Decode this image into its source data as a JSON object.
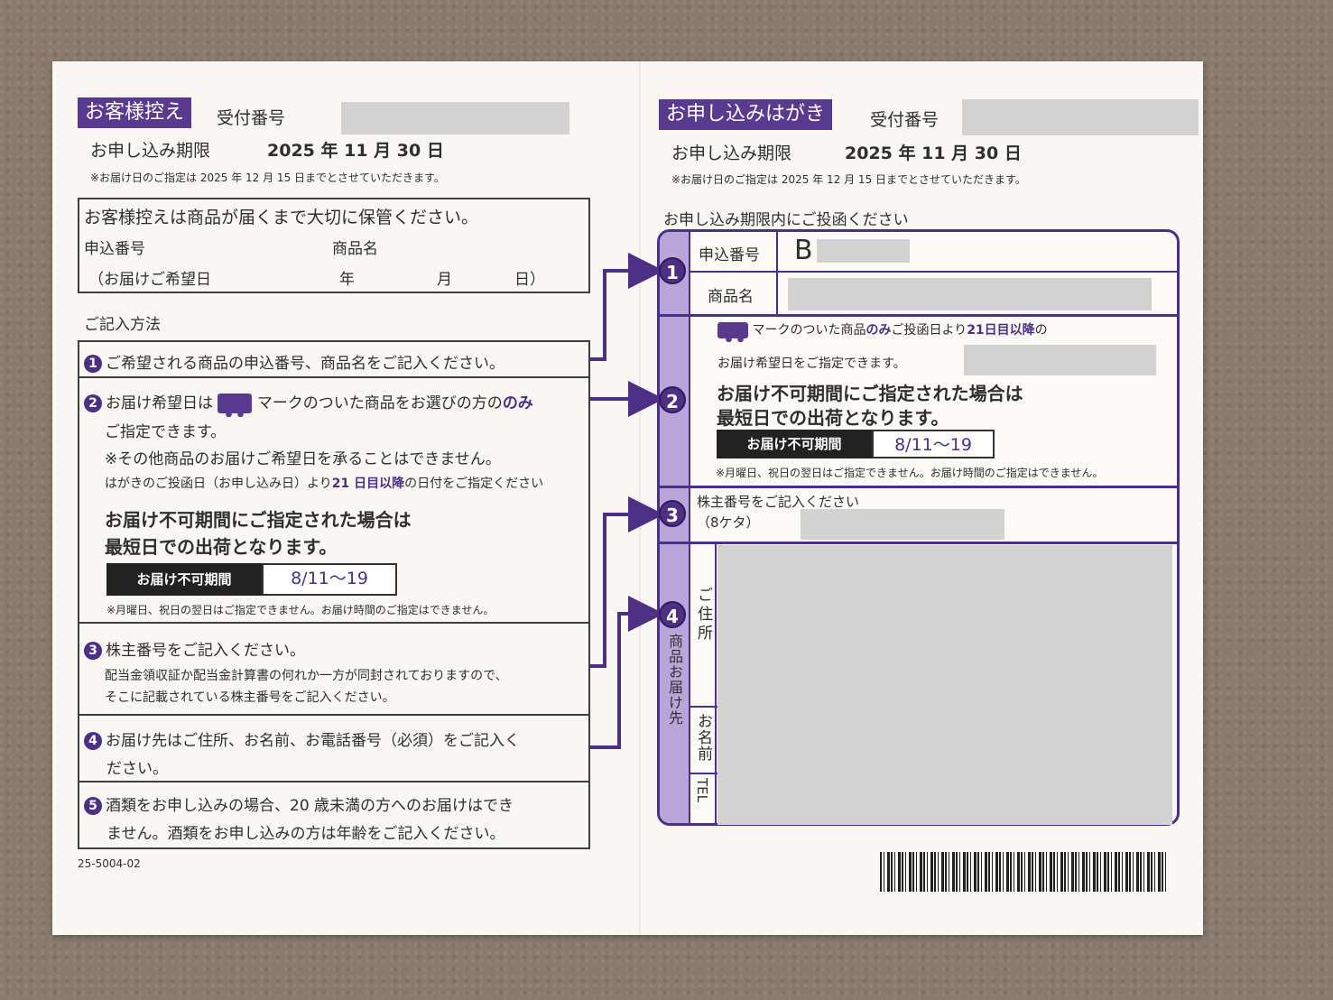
{
  "left": {
    "tag": "お客様控え",
    "receipt_label": "受付番号",
    "deadline_label": "お申し込み期限",
    "deadline_value": "2025 年 11 月 30 日",
    "note_delivery": "※お届け日のご指定は 2025 年 12 月 15 日までとさせていただきます。",
    "keep_box": {
      "heading": "お客様控えは商品が届くまで大切に保管ください。",
      "app_no": "申込番号",
      "product": "商品名",
      "date_open": "（お届けご希望日",
      "year": "年",
      "month": "月",
      "day": "日）"
    },
    "howto_title": "ご記入方法",
    "steps": {
      "s1": "ご希望される商品の申込番号、商品名をご記入ください。",
      "s2_a": "お届け希望日は",
      "s2_b": "マークのついた商品をお選びの方の",
      "s2_only": "のみ",
      "s2_c": "ご指定できます。",
      "s2_d": "※その他商品のお届けご希望日を承ることはできません。",
      "s2_e1": "はがきのご投函日（お申し込み日）より",
      "s2_e2": "21 日目以降",
      "s2_e3": "の日付をご指定ください",
      "s2_f": "お届け不可期間にご指定された場合は",
      "s2_g": "最短日での出荷となります。",
      "ng_label": "お届け不可期間",
      "ng_value": "8/11～19",
      "s2_h": "※月曜日、祝日の翌日はご指定できません。お届け時間のご指定はできません。",
      "s3_a": "株主番号をご記入ください。",
      "s3_b": "配当金領収証か配当金計算書の何れか一方が同封されておりますので、",
      "s3_c": "そこに記載されている株主番号をご記入ください。",
      "s4_a": "お届け先はご住所、お名前、お電話番号（必須）をご記入く",
      "s4_b": "ださい。",
      "s5_a": "酒類をお申し込みの場合、20 歳未満の方へのお届けはでき",
      "s5_b": "ません。酒類をお申し込みの方は年齢をご記入ください。"
    },
    "code": "25-5004-02",
    "nums": [
      "1",
      "2",
      "3",
      "4",
      "5"
    ]
  },
  "right": {
    "tag": "お申し込みはがき",
    "receipt_label": "受付番号",
    "deadline_label": "お申し込み期限",
    "deadline_value": "2025 年 11 月 30 日",
    "note_delivery": "※お届け日のご指定は 2025 年 12 月 15 日までとさせていただきます。",
    "post_note": "お申し込み期限内にご投函ください",
    "app_no_label": "申込番号",
    "app_no_prefix": "B",
    "product_label": "商品名",
    "sec2_a": "マークのついた商品",
    "sec2_only": "のみ",
    "sec2_b": "ご投函日より",
    "sec2_c": "21日目以降",
    "sec2_d": "の",
    "sec2_e": "お届け希望日をご指定できます。",
    "sec2_f": "お届け不可期間にご指定された場合は",
    "sec2_g": "最短日での出荷となります。",
    "ng_label": "お届け不可期間",
    "ng_value": "8/11～19",
    "sec2_h": "※月曜日、祝日の翌日はご指定できません。お届け時間のご指定はできません。",
    "sec3_a": "株主番号をご記入ください",
    "sec3_b": "（8ケタ）",
    "side_label": "商品お届け先",
    "address_label": "ご住所",
    "name_label": "お名前",
    "tel_label": "TEL",
    "nums": [
      "1",
      "2",
      "3",
      "4"
    ]
  },
  "colors": {
    "accent": "#4e2f86",
    "paper": "#f8f7f4",
    "background": "#8a7a6c"
  },
  "icons": [
    "delivery-truck-icon",
    "barcode-icon",
    "arrow-icon"
  ]
}
